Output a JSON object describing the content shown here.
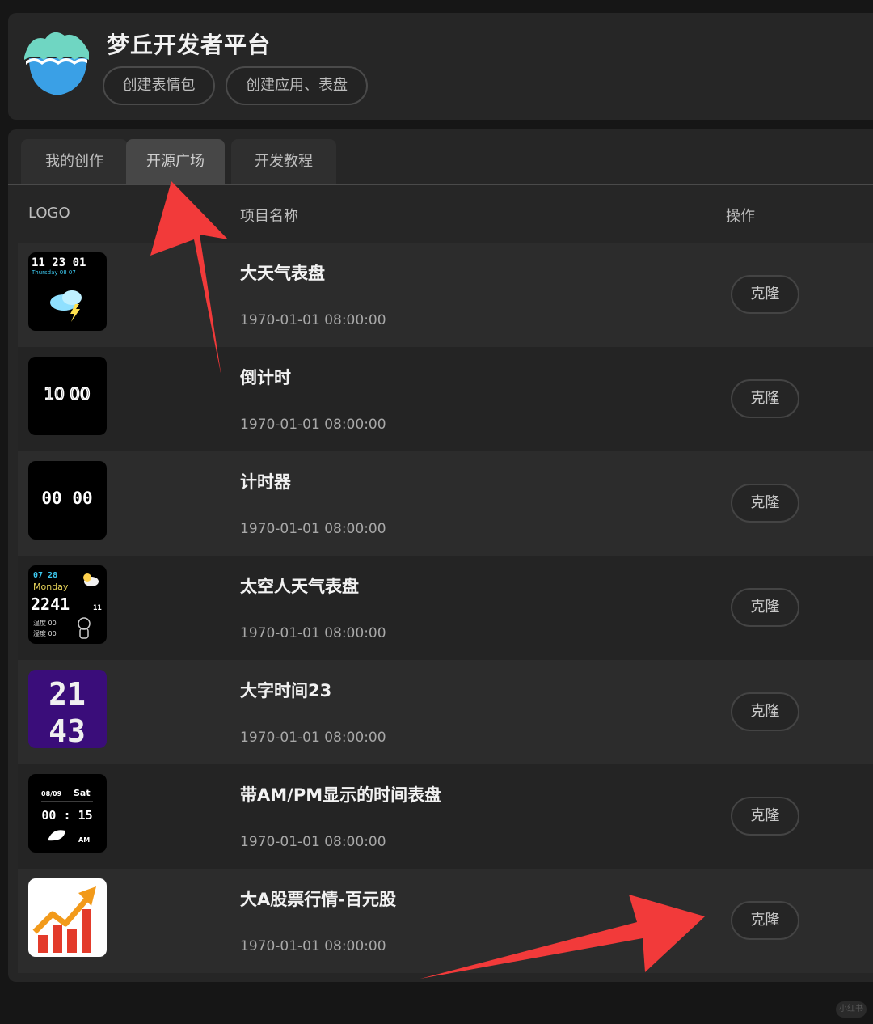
{
  "header": {
    "title": "梦丘开发者平台",
    "buttons": [
      "创建表情包",
      "创建应用、表盘"
    ]
  },
  "tabs": [
    {
      "label": "我的创作",
      "active": false
    },
    {
      "label": "开源广场",
      "active": true
    },
    {
      "label": "开发教程",
      "active": false
    }
  ],
  "columns": {
    "logo": "LOGO",
    "name": "项目名称",
    "action": "操作"
  },
  "rows": [
    {
      "name": "大天气表盘",
      "date": "1970-01-01 08:00:00",
      "action": "克隆",
      "thumb": {
        "lines": [
          "11 23 01",
          "Thursday 08 07"
        ],
        "icon": "cloud-lightning-icon"
      }
    },
    {
      "name": "倒计时",
      "date": "1970-01-01 08:00:00",
      "action": "克隆",
      "thumb": {
        "text": "10 00"
      }
    },
    {
      "name": "计时器",
      "date": "1970-01-01 08:00:00",
      "action": "克隆",
      "thumb": {
        "text": "00 00"
      }
    },
    {
      "name": "太空人天气表盘",
      "date": "1970-01-01 08:00:00",
      "action": "克隆",
      "thumb": {
        "lines": [
          "07 28",
          "Monday",
          "2241",
          "11",
          "温度 00",
          "湿度 00"
        ]
      }
    },
    {
      "name": "大字时间23",
      "date": "1970-01-01 08:00:00",
      "action": "克隆",
      "thumb": {
        "lines": [
          "21",
          "43"
        ]
      }
    },
    {
      "name": "带AM/PM显示的时间表盘",
      "date": "1970-01-01 08:00:00",
      "action": "克隆",
      "thumb": {
        "lines": [
          "08/09",
          "Sat",
          "00 : 15",
          "AM"
        ]
      }
    },
    {
      "name": "大A股票行情-百元股",
      "date": "1970-01-01 08:00:00",
      "action": "克隆",
      "thumb": {
        "icon": "stock-chart-icon"
      }
    }
  ],
  "watermark": "小红书",
  "colors": {
    "accent_arrow": "#f23a3a",
    "background": "#161616",
    "panel": "#262626"
  }
}
